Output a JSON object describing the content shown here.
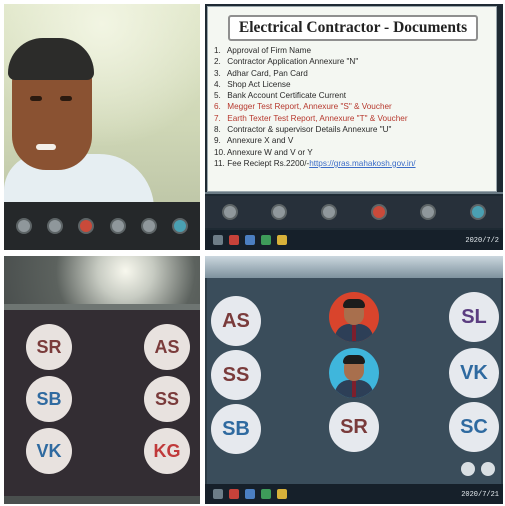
{
  "document": {
    "title": "Electrical Contractor - Documents",
    "items": [
      {
        "num": "1.",
        "text": "Approval of Firm Name",
        "red": false
      },
      {
        "num": "2.",
        "text": "Contractor Application Annexure \"N\"",
        "red": false
      },
      {
        "num": "3.",
        "text": "Adhar Card, Pan Card",
        "red": false
      },
      {
        "num": "4.",
        "text": "Shop Act License",
        "red": false
      },
      {
        "num": "5.",
        "text": "Bank Account Certificate Current",
        "red": false
      },
      {
        "num": "6.",
        "text": "Megger Test Report, Annexure \"S\" & Voucher",
        "red": true
      },
      {
        "num": "7.",
        "text": "Earth Texter Test Report, Annexure \"T\" & Voucher",
        "red": true
      },
      {
        "num": "8.",
        "text": "Contractor & supervisor Details Annexure \"U\"",
        "red": false
      },
      {
        "num": "9.",
        "text": "Annexure X and V",
        "red": false
      },
      {
        "num": "10.",
        "text": "Annexure W and V or Y",
        "red": false
      }
    ],
    "fee_num": "11.",
    "fee_text": "Fee Reciept  Rs.2200/-",
    "fee_link": "https://gras.mahakosh.gov.in/"
  },
  "timestamps": {
    "top_right": "2020/7/2",
    "bottom_right": "2020/7/21"
  },
  "grid_left": {
    "participants": [
      {
        "initials": "SR",
        "color": "#7a3b3b"
      },
      {
        "initials": "AS",
        "color": "#7a3b3b"
      },
      {
        "initials": "SB",
        "color": "#2f6aa0"
      },
      {
        "initials": "SS",
        "color": "#7a3b3b"
      },
      {
        "initials": "VK",
        "color": "#2f6aa0"
      },
      {
        "initials": "KG",
        "color": "#c0393a"
      }
    ]
  },
  "grid_right": {
    "participants": [
      {
        "initials": "AS",
        "color": "#7a3b3b"
      },
      {
        "initials": "SL",
        "color": "#5b3d80"
      },
      {
        "initials": "SS",
        "color": "#7a3b3b"
      },
      {
        "initials": "VK",
        "color": "#2f6aa0"
      },
      {
        "initials": "SB",
        "color": "#2f6aa0"
      },
      {
        "initials": "SR",
        "color": "#7a3b3b"
      },
      {
        "initials": "SC",
        "color": "#2f6aa0"
      }
    ]
  }
}
